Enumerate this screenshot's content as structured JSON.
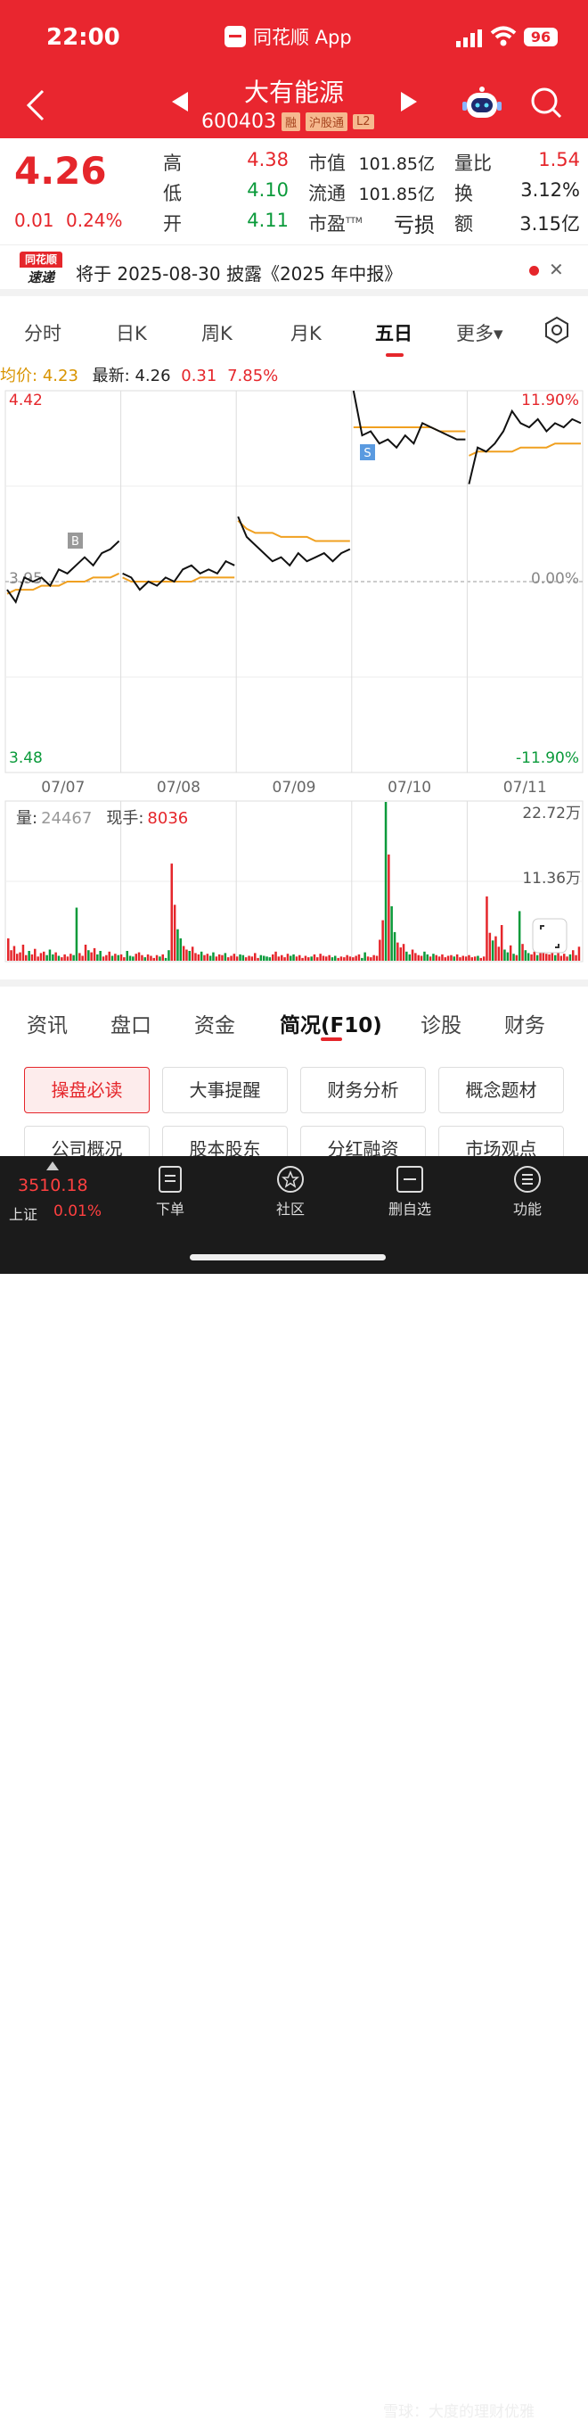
{
  "status_bar": {
    "time": "22:00",
    "battery": "96"
  },
  "app_title": "同花顺 App",
  "stock": {
    "name": "大有能源",
    "code": "600403",
    "tags": [
      "融",
      "沪股通",
      "L2"
    ]
  },
  "quote": {
    "price": "4.26",
    "change": "0.01",
    "change_pct": "0.24%",
    "high_label": "高",
    "high": "4.38",
    "low_label": "低",
    "low": "4.10",
    "open_label": "开",
    "open": "4.11",
    "mktcap_label": "市值",
    "mktcap": "101.85亿",
    "float_label": "流通",
    "float": "101.85亿",
    "pe_label": "市盈",
    "pe_sup": "TTM",
    "pe": "亏损",
    "vr_label": "量比",
    "vr": "1.54",
    "turnover_label": "换",
    "turnover": "3.12%",
    "amount_label": "额",
    "amount": "3.15亿"
  },
  "news": {
    "logo_top": "同花顺",
    "logo_bottom": "速递",
    "text": "将于 2025-08-30 披露《2025 年中报》"
  },
  "period_tabs": [
    "分时",
    "日K",
    "周K",
    "月K",
    "五日",
    "更多▾"
  ],
  "active_period": "五日",
  "legend": {
    "avg_label": "均价:",
    "avg": "4.23",
    "last_label": "最新:",
    "last": "4.26",
    "chg": "0.31",
    "pct": "7.85%"
  },
  "chart_data": {
    "type": "line",
    "dates": [
      "07/07",
      "07/08",
      "07/09",
      "07/10",
      "07/11"
    ],
    "ylim": [
      3.48,
      4.42
    ],
    "y_labels": {
      "top": "4.42",
      "mid": "3.95",
      "bottom": "3.48"
    },
    "pct_labels": {
      "top": "11.90%",
      "mid": "0.00%",
      "bottom": "-11.90%"
    },
    "markers": {
      "buy": "B",
      "sell": "S"
    },
    "series": [
      {
        "values": [
          3.93,
          3.9,
          3.96,
          3.95,
          3.96,
          3.94,
          3.98,
          3.97,
          3.99,
          4.01,
          3.99,
          4.02,
          4.03,
          4.05,
          3.97,
          3.96,
          3.93,
          3.95,
          3.94,
          3.96,
          3.95,
          3.98,
          3.99,
          3.97,
          3.98,
          3.97,
          4.0,
          3.99,
          4.11,
          4.06,
          4.04,
          4.02,
          4.0,
          4.01,
          3.99,
          4.02,
          4.0,
          4.01,
          4.02,
          4.0,
          4.02,
          4.03,
          4.42,
          4.31,
          4.32,
          4.29,
          4.3,
          4.28,
          4.31,
          4.29,
          4.34,
          4.33,
          4.32,
          4.31,
          4.3,
          4.3,
          4.19,
          4.28,
          4.27,
          4.29,
          4.32,
          4.37,
          4.34,
          4.33,
          4.35,
          4.32,
          4.34,
          4.33,
          4.35,
          4.34
        ]
      },
      {
        "values": [
          3.92,
          3.93,
          3.93,
          3.93,
          3.94,
          3.94,
          3.94,
          3.95,
          3.95,
          3.95,
          3.96,
          3.96,
          3.96,
          3.97,
          3.96,
          3.95,
          3.95,
          3.95,
          3.95,
          3.95,
          3.95,
          3.95,
          3.95,
          3.96,
          3.96,
          3.96,
          3.96,
          3.96,
          4.1,
          4.08,
          4.07,
          4.07,
          4.07,
          4.06,
          4.06,
          4.06,
          4.06,
          4.05,
          4.05,
          4.05,
          4.05,
          4.05,
          4.33,
          4.33,
          4.33,
          4.33,
          4.33,
          4.33,
          4.33,
          4.33,
          4.33,
          4.33,
          4.32,
          4.32,
          4.32,
          4.32,
          4.26,
          4.27,
          4.27,
          4.27,
          4.27,
          4.27,
          4.28,
          4.28,
          4.28,
          4.28,
          4.29,
          4.29,
          4.29,
          4.29
        ]
      }
    ],
    "volume": {
      "label": "量:",
      "value": "24467",
      "hand_label": "现手:",
      "hand": "8036",
      "ymax_label": "22.72万",
      "ymid_label": "11.36万",
      "ymax": 22.72,
      "values": [
        3.2,
        1.5,
        2.1,
        1.0,
        1.2,
        2.3,
        0.8,
        1.4,
        0.9,
        1.7,
        0.6,
        1.1,
        1.3,
        0.8,
        1.6,
        0.9,
        1.2,
        0.7,
        0.5,
        0.9,
        0.6,
        1.0,
        0.8,
        7.6,
        1.1,
        0.7,
        2.3,
        1.5,
        1.2,
        1.8,
        0.9,
        1.4,
        0.6,
        0.8,
        1.3,
        0.7,
        1.0,
        0.8,
        0.9,
        0.5,
        1.4,
        0.7,
        0.6,
        1.0,
        1.2,
        0.8,
        0.5,
        0.9,
        0.7,
        0.4,
        0.8,
        0.6,
        0.9,
        0.4,
        1.5,
        13.9,
        8.0,
        4.5,
        3.2,
        2.1,
        1.6,
        1.4,
        2.0,
        1.1,
        0.9,
        1.3,
        0.8,
        1.0,
        0.7,
        1.2,
        0.6,
        0.9,
        0.8,
        1.1,
        0.5,
        0.7,
        1.0,
        0.6,
        0.9,
        0.8,
        0.5,
        0.7,
        0.6,
        1.1,
        0.4,
        0.8,
        0.7,
        0.6,
        0.5,
        0.9,
        1.3,
        0.6,
        0.8,
        0.5,
        1.0,
        0.7,
        0.9,
        0.6,
        0.8,
        0.4,
        0.7,
        0.5,
        0.6,
        0.9,
        0.5,
        1.0,
        0.7,
        0.6,
        0.8,
        0.5,
        0.7,
        0.4,
        0.6,
        0.5,
        0.8,
        0.6,
        0.5,
        0.7,
        0.9,
        0.4,
        1.2,
        0.6,
        0.5,
        0.8,
        0.7,
        3.0,
        5.8,
        22.72,
        15.2,
        7.8,
        4.1,
        2.6,
        1.9,
        2.4,
        1.3,
        0.9,
        1.6,
        1.1,
        0.8,
        0.7,
        1.3,
        0.9,
        0.6,
        1.0,
        0.8,
        0.6,
        0.9,
        0.5,
        0.7,
        0.8,
        0.6,
        0.9,
        0.5,
        0.7,
        0.6,
        0.8,
        0.5,
        0.6,
        0.7,
        0.4,
        0.6,
        9.2,
        4.0,
        2.9,
        3.5,
        2.0,
        5.1,
        1.6,
        1.2,
        2.2,
        1.0,
        0.8,
        7.1,
        2.4,
        1.5,
        1.1,
        0.9,
        1.3,
        0.8,
        1.7,
        2.5,
        1.0,
        0.9,
        1.4,
        0.8,
        1.2,
        0.7,
        1.0,
        0.6,
        0.9,
        1.5,
        0.8,
        2.0
      ]
    }
  },
  "bottom_tabs": [
    "资讯",
    "盘口",
    "资金",
    "简况(F10)",
    "诊股",
    "财务"
  ],
  "active_bottom_tab": "简况(F10)",
  "f10_buttons": [
    "操盘必读",
    "大事提醒",
    "财务分析",
    "概念题材",
    "公司概况",
    "股本股东",
    "分红融资",
    "市场观点"
  ],
  "bottom_nav": {
    "index_value": "3510.18",
    "index_name": "上证",
    "index_pct": "0.01%",
    "items": [
      "下单",
      "社区",
      "删自选",
      "功能"
    ]
  },
  "watermark": "雪球：大度的理财优雅",
  "colors": {
    "brand_red": "#e9262f",
    "up": "#e5262b",
    "down": "#0a9a3a",
    "avg_line": "#f0a020"
  }
}
